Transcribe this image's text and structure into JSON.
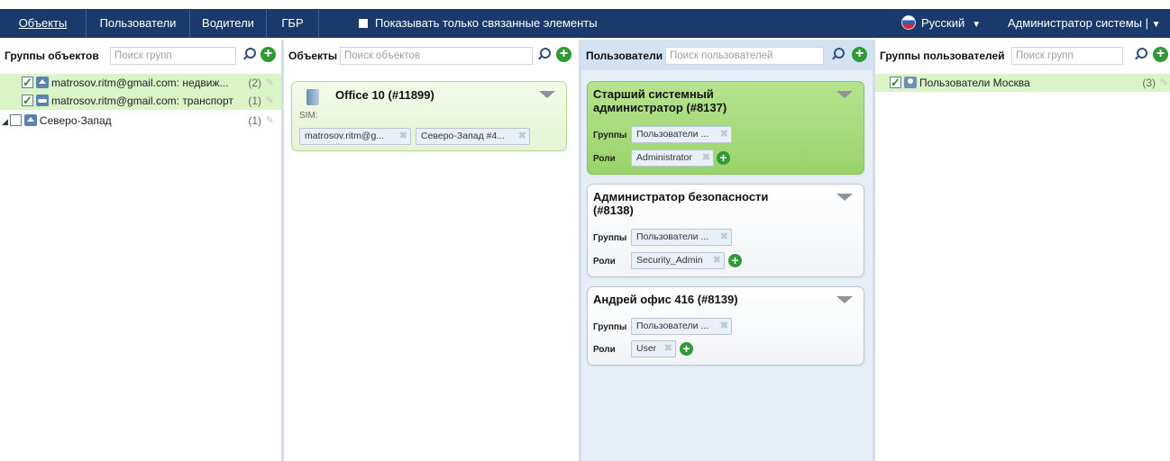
{
  "nav": {
    "tabs": [
      "Объекты",
      "Пользователи",
      "Водители",
      "ГБР"
    ],
    "filter_label": "Показывать только связанные элементы",
    "language": "Русский",
    "user": "Администратор системы"
  },
  "object_groups": {
    "title": "Группы объектов",
    "search_placeholder": "Поиск групп",
    "items": [
      {
        "label": "matrosov.ritm@gmail.com: недвиж...",
        "count": "(2)"
      },
      {
        "label": "matrosov.ritm@gmail.com: транспорт",
        "count": "(1)"
      },
      {
        "label": "Северо-Запад",
        "count": "(1)"
      }
    ]
  },
  "objects": {
    "title": "Объекты",
    "search_placeholder": "Поиск объектов",
    "card": {
      "title": "Office 10 (#11899)",
      "sim_label": "SIM:",
      "chips": [
        "matrosov.ritm@g...",
        "Северо-Запад #4..."
      ]
    }
  },
  "users": {
    "title": "Пользователи",
    "search_placeholder": "Поиск пользователей",
    "groups_label": "Группы",
    "roles_label": "Роли",
    "cards": [
      {
        "title_line1": "Старший системный",
        "title_line2": "администратор (#8137)",
        "group": "Пользователи ...",
        "role": "Administrator"
      },
      {
        "title_line1": "Администратор безопасности",
        "title_line2": "(#8138)",
        "group": "Пользователи ...",
        "role": "Security_Admin"
      },
      {
        "title_line1": "Андрей офис 416 (#8139)",
        "title_line2": "",
        "group": "Пользователи ...",
        "role": "User"
      }
    ]
  },
  "user_groups": {
    "title": "Группы пользователей",
    "search_placeholder": "Поиск групп",
    "items": [
      {
        "label": "Пользователи Москва",
        "count": "(3)"
      }
    ]
  },
  "colors": {
    "nav_bg": "#1a3a6b",
    "selected_row": "#d9f5c7",
    "users_column_bg": "#e6eef8",
    "selected_card": "#a8dc7b",
    "add_green": "#2f9a36"
  }
}
